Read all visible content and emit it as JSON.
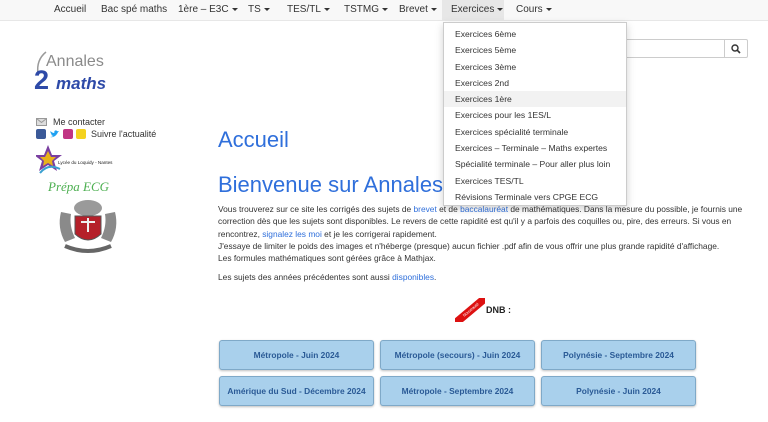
{
  "nav": {
    "items": [
      {
        "label": "Accueil",
        "caret": false
      },
      {
        "label": "Bac spé maths",
        "caret": false
      },
      {
        "label": "1ère – E3C",
        "caret": true
      },
      {
        "label": "TS",
        "caret": true
      },
      {
        "label": "TES/TL",
        "caret": true
      },
      {
        "label": "TSTMG",
        "caret": true
      },
      {
        "label": "Brevet",
        "caret": true
      },
      {
        "label": "Exercices",
        "caret": true,
        "active": true
      },
      {
        "label": "Cours",
        "caret": true
      }
    ]
  },
  "dropdown": {
    "items": [
      "Exercices 6ème",
      "Exercices 5ème",
      "Exercices 3ème",
      "Exercices 2nd",
      "Exercices 1ère",
      "Exercices pour les 1ES/L",
      "Exercices spécialité terminale",
      "Exercices – Terminale – Maths expertes",
      "Spécialité terminale – Pour aller plus loin",
      "Exercices TES/TL",
      "Révisions Terminale vers CPGE ECG"
    ],
    "hovered_index": 4
  },
  "logo": {
    "annales": "Annales",
    "two": "2",
    "maths": "maths"
  },
  "sidebar": {
    "contact_label": "Me contacter",
    "follow_label": "Suivre l'actualité",
    "lycee_name": "Lycée du Loquidy - Nantes",
    "prepa_label": "Prépa ECG"
  },
  "main": {
    "title": "Accueil",
    "welcome": "Bienvenue sur Annales",
    "para": {
      "t1": "Vous trouverez sur ce site les corrigés des sujets de ",
      "l1": "brevet",
      "t2": " et de ",
      "l2": "baccalauréat",
      "t3": " de mathématiques. Dans la mesure du possible, je fournis une correction dès que les sujets sont disponibles. Le revers de cette rapidité est qu'il y a parfois des coquilles ou, pire, des erreurs. Si vous en rencontrez, ",
      "l3": "signalez les moi",
      "t4": " et je les corrigerai rapidement.",
      "line2": "J'essaye de limiter le poids des images et n'héberge (presque) aucun fichier .pdf afin de vous offrir une plus grande rapidité d'affichage.",
      "line3": "Les formules mathématiques sont gérées grâce à Mathjax."
    },
    "para2": {
      "t1": "Les sujets des années précédentes sont aussi ",
      "l1": "disponibles",
      "t2": "."
    },
    "ribbon": "Nouveauté",
    "dnb_label": "DNB :",
    "buttons": [
      "Métropole - Juin 2024",
      "Métropole (secours) - Juin 2024",
      "Polynésie - Septembre 2024",
      "Amérique du Sud - Décembre 2024",
      "Métropole - Septembre 2024",
      "Polynésie - Juin 2024"
    ]
  },
  "colors": {
    "link": "#2f6fdb",
    "button_bg": "#a9d0ec",
    "button_text": "#2a5a96",
    "brand": "#2e4aa8"
  }
}
